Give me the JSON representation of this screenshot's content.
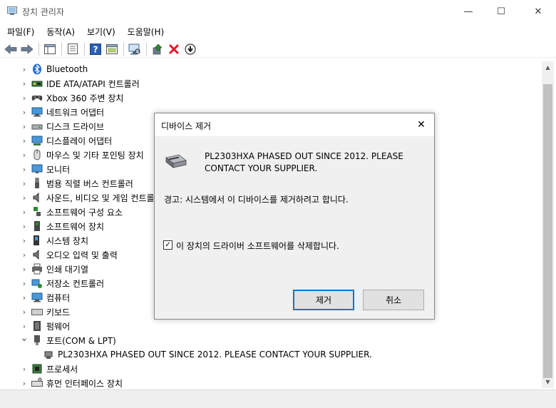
{
  "window": {
    "title": "장치 관리자",
    "min": "—",
    "max": "☐",
    "close": "✕"
  },
  "menu": [
    "파일(F)",
    "동작(A)",
    "보기(V)",
    "도움말(H)"
  ],
  "tree": {
    "items": [
      {
        "label": "Bluetooth",
        "icon": "bluetooth-icon",
        "expanded": false
      },
      {
        "label": "IDE ATA/ATAPI 컨트롤러",
        "icon": "ide-controller-icon",
        "expanded": false
      },
      {
        "label": "Xbox 360 주변 장치",
        "icon": "gamepad-icon",
        "expanded": false
      },
      {
        "label": "네트워크 어댑터",
        "icon": "network-adapter-icon",
        "expanded": false
      },
      {
        "label": "디스크 드라이브",
        "icon": "disk-drive-icon",
        "expanded": false
      },
      {
        "label": "디스플레이 어댑터",
        "icon": "display-adapter-icon",
        "expanded": false
      },
      {
        "label": "마우스 및 기타 포인팅 장치",
        "icon": "mouse-icon",
        "expanded": false
      },
      {
        "label": "모니터",
        "icon": "monitor-icon",
        "expanded": false
      },
      {
        "label": "범용 직렬 버스 컨트롤러",
        "icon": "usb-icon",
        "expanded": false
      },
      {
        "label": "사운드, 비디오 및 게임 컨트롤러",
        "icon": "speaker-icon",
        "expanded": false
      },
      {
        "label": "소프트웨어 구성 요소",
        "icon": "software-component-icon",
        "expanded": false
      },
      {
        "label": "소프트웨어 장치",
        "icon": "software-device-icon",
        "expanded": false
      },
      {
        "label": "시스템 장치",
        "icon": "system-device-icon",
        "expanded": false
      },
      {
        "label": "오디오 입력 및 출력",
        "icon": "audio-icon",
        "expanded": false
      },
      {
        "label": "인쇄 대기열",
        "icon": "printer-icon",
        "expanded": false
      },
      {
        "label": "저장소 컨트롤러",
        "icon": "storage-controller-icon",
        "expanded": false
      },
      {
        "label": "컴퓨터",
        "icon": "computer-icon",
        "expanded": false
      },
      {
        "label": "키보드",
        "icon": "keyboard-icon",
        "expanded": false
      },
      {
        "label": "펌웨어",
        "icon": "firmware-icon",
        "expanded": false
      },
      {
        "label": "포트(COM & LPT)",
        "icon": "port-icon",
        "expanded": true
      },
      {
        "label": "PL2303HXA PHASED OUT SINCE 2012. PLEASE CONTACT YOUR SUPPLIER.",
        "icon": "serial-port-icon",
        "child": true
      },
      {
        "label": "프로세서",
        "icon": "processor-icon",
        "expanded": false
      },
      {
        "label": "휴먼 인터페이스 장치",
        "icon": "hid-icon",
        "expanded": false
      }
    ]
  },
  "dialog": {
    "title": "디바이스 제거",
    "close": "✕",
    "device_name": "PL2303HXA PHASED OUT SINCE 2012. PLEASE CONTACT YOUR SUPPLIER.",
    "warning": "경고: 시스템에서 이 디바이스를 제거하려고 합니다.",
    "checkbox_label": "이 장치의 드라이버 소프트웨어를 삭제합니다.",
    "checkbox_checked": true,
    "check_mark": "✓",
    "ok_label": "제거",
    "cancel_label": "취소"
  },
  "colors": {
    "accent": "#0078d7",
    "delete_red": "#e81123",
    "enable_green": "#2e8b2e"
  }
}
